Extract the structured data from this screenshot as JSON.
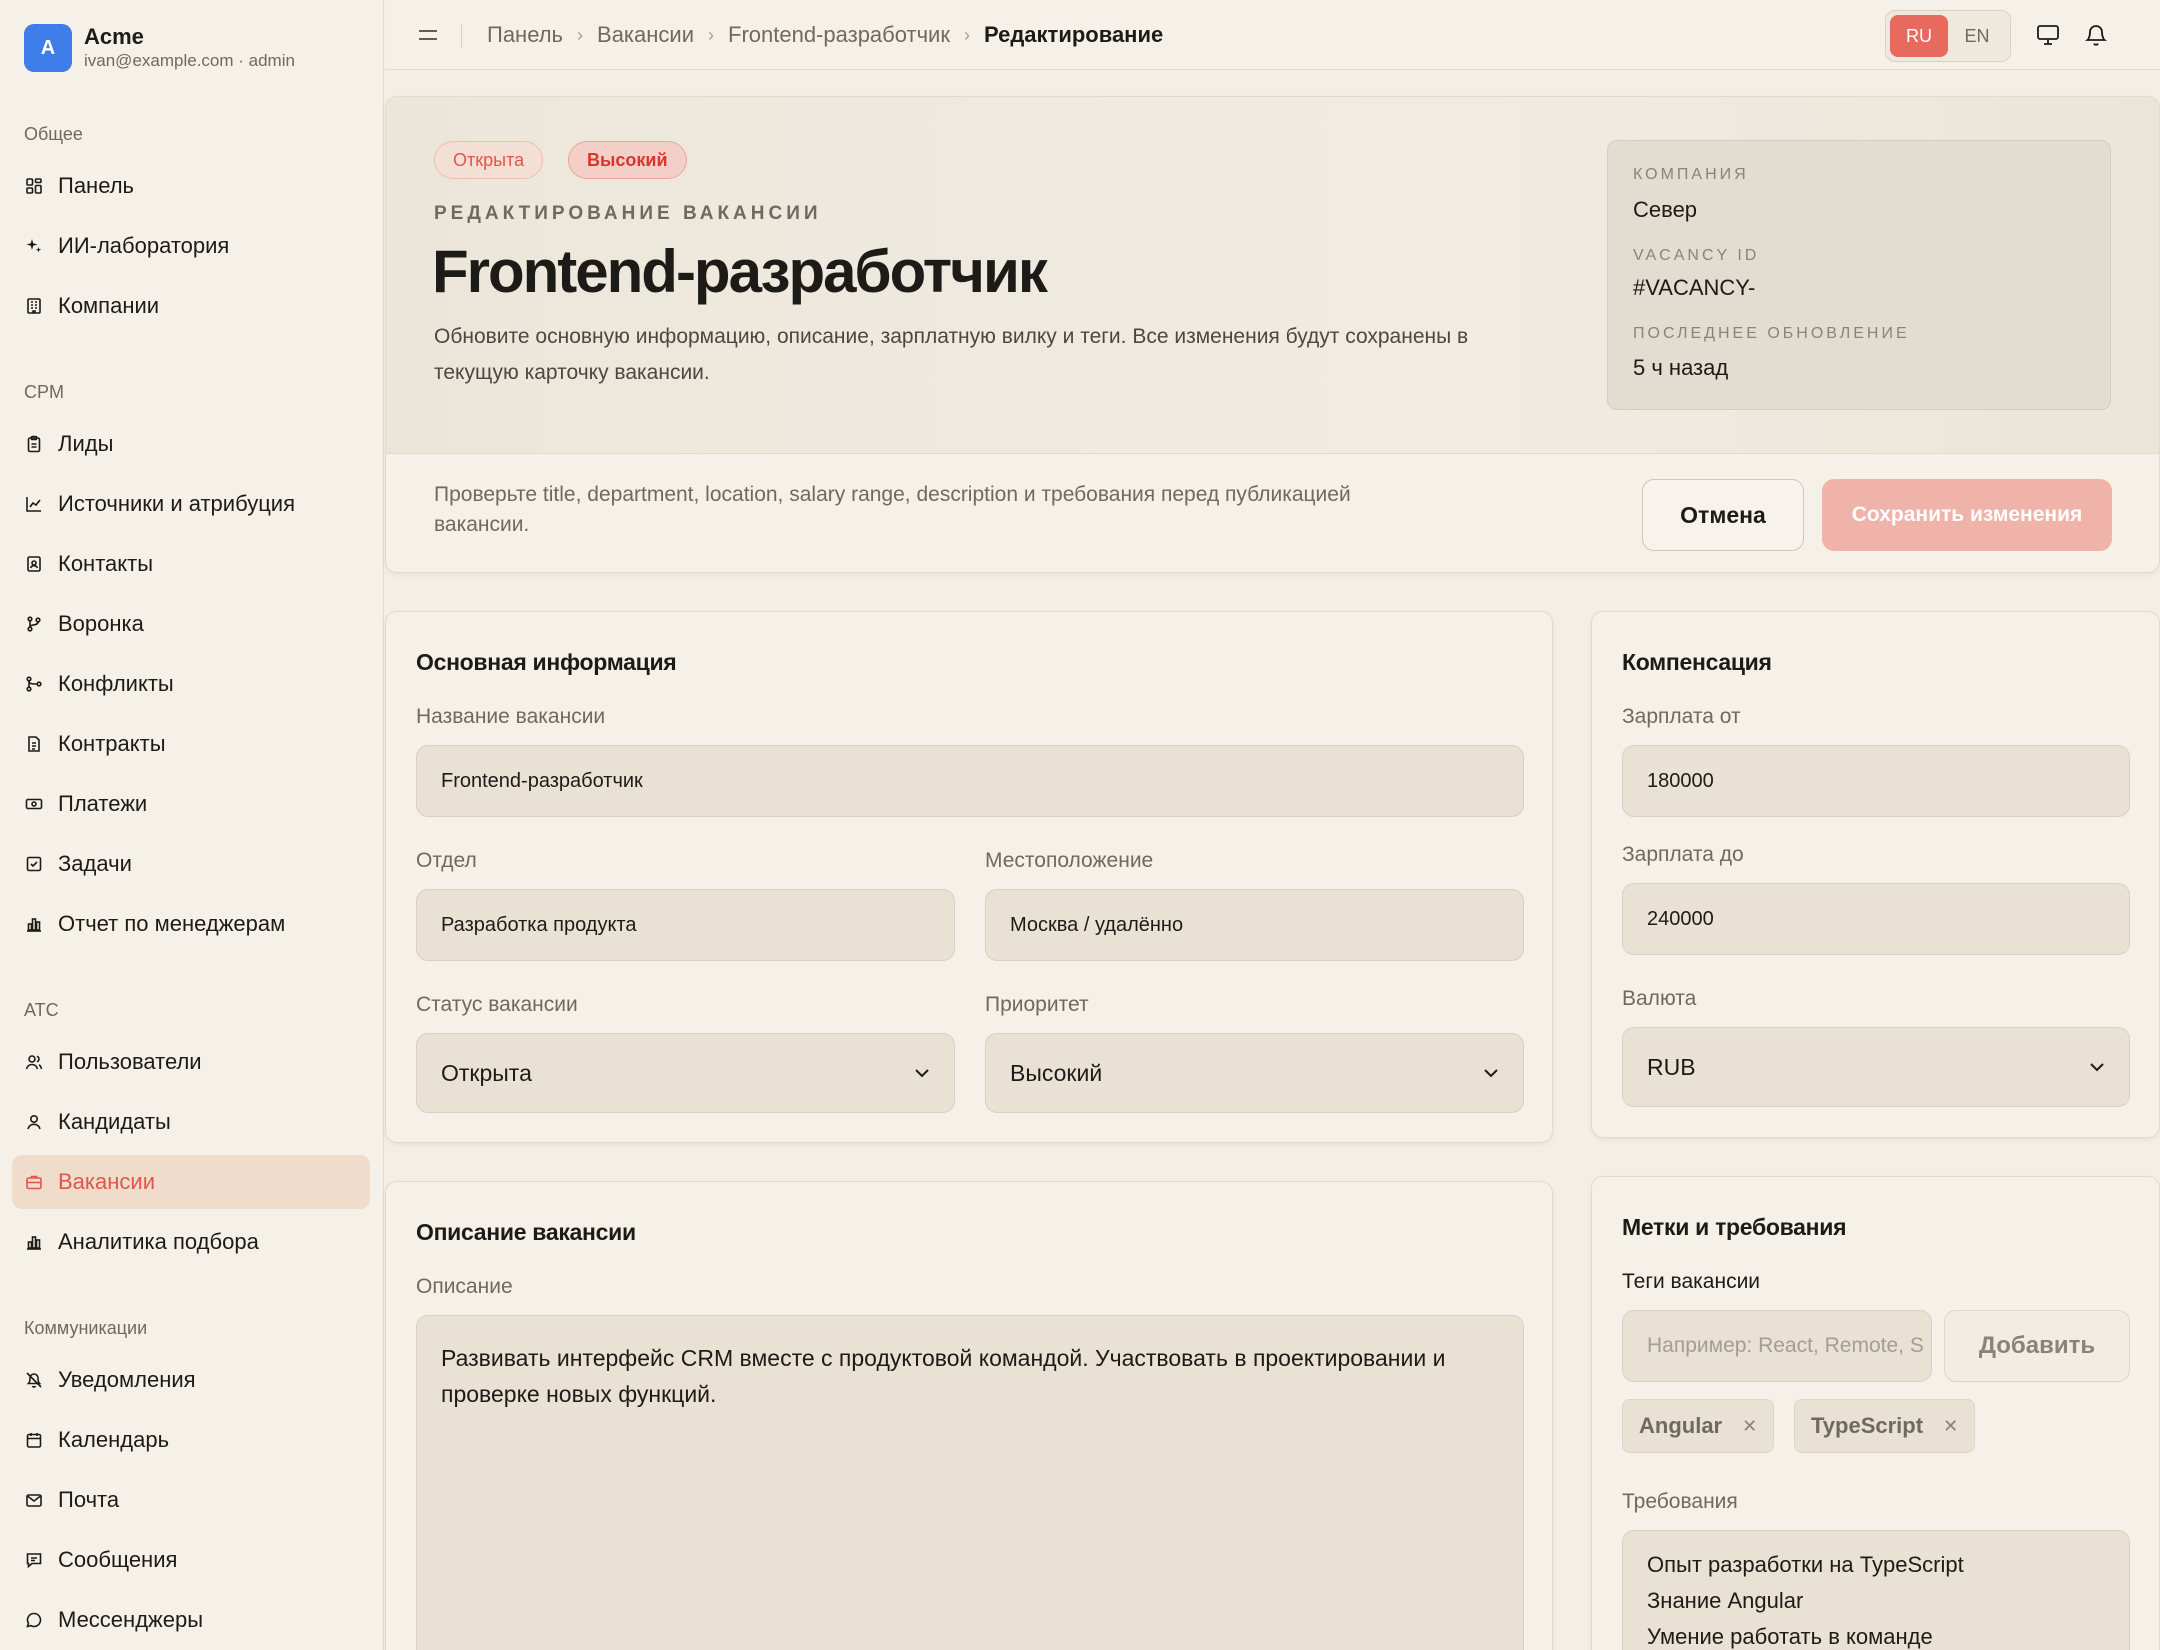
{
  "brand": {
    "initial": "A",
    "name": "Acme",
    "sub": "ivan@example.com · admin"
  },
  "sidebar": {
    "sections": [
      {
        "title": "Общее",
        "items": [
          {
            "label": "Панель",
            "icon": "grid-icon"
          },
          {
            "label": "ИИ-лаборатория",
            "icon": "sparkles-icon"
          },
          {
            "label": "Компании",
            "icon": "building-icon"
          }
        ]
      },
      {
        "title": "CPM",
        "items": [
          {
            "label": "Лиды",
            "icon": "clipboard-icon"
          },
          {
            "label": "Источники и атрибуция",
            "icon": "line-chart-icon"
          },
          {
            "label": "Контакты",
            "icon": "contact-icon"
          },
          {
            "label": "Воронка",
            "icon": "git-branch-icon"
          },
          {
            "label": "Конфликты",
            "icon": "git-merge-icon"
          },
          {
            "label": "Контракты",
            "icon": "document-icon"
          },
          {
            "label": "Платежи",
            "icon": "banknote-icon"
          },
          {
            "label": "Задачи",
            "icon": "checkbox-icon"
          },
          {
            "label": "Отчет по менеджерам",
            "icon": "bar-chart-icon"
          }
        ]
      },
      {
        "title": "ATC",
        "items": [
          {
            "label": "Пользователи",
            "icon": "users-icon"
          },
          {
            "label": "Кандидаты",
            "icon": "user-icon"
          },
          {
            "label": "Вакансии",
            "icon": "briefcase-icon",
            "active": true
          },
          {
            "label": "Аналитика подбора",
            "icon": "bar-chart-icon"
          }
        ]
      },
      {
        "title": "Коммуникации",
        "items": [
          {
            "label": "Уведомления",
            "icon": "bell-off-icon"
          },
          {
            "label": "Календарь",
            "icon": "calendar-icon"
          },
          {
            "label": "Почта",
            "icon": "mail-icon"
          },
          {
            "label": "Сообщения",
            "icon": "message-square-icon"
          },
          {
            "label": "Мессенджеры",
            "icon": "message-circle-icon"
          }
        ]
      }
    ]
  },
  "topbar": {
    "breadcrumb": [
      "Панель",
      "Вакансии",
      "Frontend-разработчик",
      "Редактирование"
    ],
    "lang": {
      "ru": "RU",
      "en": "EN",
      "active": "RU"
    }
  },
  "hero": {
    "badge_status": "Открыта",
    "badge_priority": "Высокий",
    "eyebrow": "РЕДАКТИРОВАНИЕ ВАКАНСИИ",
    "title": "Frontend-разработчик",
    "description": "Обновите основную информацию, описание, зарплатную вилку и теги. Все изменения будут сохранены в текущую карточку вакансии.",
    "meta": {
      "company_label": "КОМПАНИЯ",
      "company": "Север",
      "id_label": "VACANCY ID",
      "id": "#VACANCY-",
      "updated_label": "ПОСЛЕДНЕЕ ОБНОВЛЕНИЕ",
      "updated": "5 ч назад"
    },
    "hint": "Проверьте title, department, location, salary range, description и требования перед публикацией вакансии.",
    "cancel": "Отмена",
    "save": "Сохранить изменения"
  },
  "basic": {
    "title": "Основная информация",
    "name_label": "Название вакансии",
    "name_value": "Frontend-разработчик",
    "dept_label": "Отдел",
    "dept_value": "Разработка продукта",
    "location_label": "Местоположение",
    "location_value": "Москва / удалённо",
    "status_label": "Статус вакансии",
    "status_value": "Открыта",
    "priority_label": "Приоритет",
    "priority_value": "Высокий"
  },
  "compensation": {
    "title": "Компенсация",
    "from_label": "Зарплата от",
    "from_value": "180000",
    "to_label": "Зарплата до",
    "to_value": "240000",
    "currency_label": "Валюта",
    "currency_value": "RUB"
  },
  "description": {
    "title": "Описание вакансии",
    "label": "Описание",
    "value": "Развивать интерфейс CRM вместе с продуктовой командой. Участвовать в проектировании и проверке новых функций."
  },
  "tags": {
    "title": "Метки и требования",
    "tags_label": "Теги вакансии",
    "placeholder": "Например: React, Remote, S",
    "add": "Добавить",
    "items": [
      "Angular",
      "TypeScript"
    ],
    "requirements_label": "Требования",
    "requirements": [
      "Опыт разработки на TypeScript",
      "Знание Angular",
      "Умение работать в команде"
    ]
  },
  "colors": {
    "accent": "#e86a5e",
    "brand": "#3f7ee8",
    "background": "#f3efe6"
  }
}
